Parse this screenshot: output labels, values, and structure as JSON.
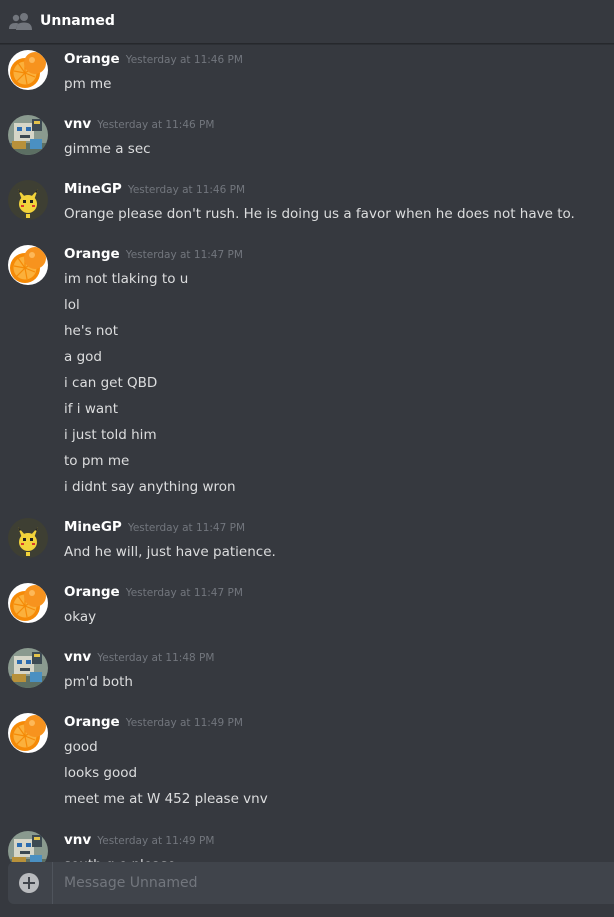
{
  "header": {
    "icon": "people-icon",
    "title": "Unnamed"
  },
  "colors": {
    "background": "#36393f",
    "author": "#ffffff",
    "text": "#dcddde",
    "timestamp": "#72767d",
    "input_background": "#40444b"
  },
  "messages": [
    {
      "author": "Orange",
      "avatar": "orange-slice-icon",
      "timestamp": "Yesterday at 11:46 PM",
      "lines": [
        "pm me"
      ]
    },
    {
      "author": "vnv",
      "avatar": "robot-avatar-icon",
      "timestamp": "Yesterday at 11:46 PM",
      "lines": [
        "gimme a sec"
      ]
    },
    {
      "author": "MineGP",
      "avatar": "pikachu-avatar-icon",
      "timestamp": "Yesterday at 11:46 PM",
      "lines": [
        "Orange please don't rush. He is doing us a favor when he does not have to."
      ]
    },
    {
      "author": "Orange",
      "avatar": "orange-slice-icon",
      "timestamp": "Yesterday at 11:47 PM",
      "lines": [
        "im not tlaking to u",
        "lol",
        "he's not",
        "a god",
        "i can get QBD",
        "if i want",
        "i just told him",
        "to pm me",
        "i didnt say anything wron"
      ]
    },
    {
      "author": "MineGP",
      "avatar": "pikachu-avatar-icon",
      "timestamp": "Yesterday at 11:47 PM",
      "lines": [
        "And he will, just have patience."
      ]
    },
    {
      "author": "Orange",
      "avatar": "orange-slice-icon",
      "timestamp": "Yesterday at 11:47 PM",
      "lines": [
        "okay"
      ]
    },
    {
      "author": "vnv",
      "avatar": "robot-avatar-icon",
      "timestamp": "Yesterday at 11:48 PM",
      "lines": [
        "pm'd both"
      ]
    },
    {
      "author": "Orange",
      "avatar": "orange-slice-icon",
      "timestamp": "Yesterday at 11:49 PM",
      "lines": [
        "good",
        "looks good",
        "meet me at W 452 please vnv"
      ]
    },
    {
      "author": "vnv",
      "avatar": "robot-avatar-icon",
      "timestamp": "Yesterday at 11:49 PM",
      "lines": [
        "south g.e please"
      ]
    }
  ],
  "input": {
    "attach_icon": "plus-circle-icon",
    "placeholder": "Message Unnamed",
    "value": ""
  }
}
